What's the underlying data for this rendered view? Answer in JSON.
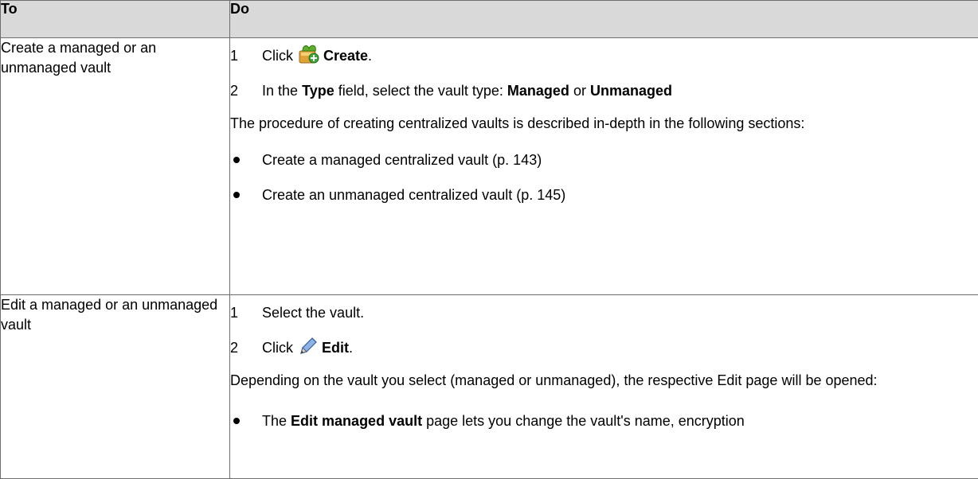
{
  "table": {
    "headers": [
      "To",
      "Do"
    ],
    "rows": [
      {
        "to": "Create a managed or an unmanaged vault",
        "steps": [
          {
            "num": "1",
            "pre": "Click",
            "bold": "Create",
            "post": ".",
            "icon": "create-vault-icon"
          },
          {
            "num": "2",
            "pre": "In the",
            "bold": "Type",
            "mid": "field, select the vault type:",
            "bold2": "Managed",
            "or": "or",
            "bold3": "Unmanaged"
          }
        ],
        "para": "The procedure of creating centralized vaults is described in-depth in the following sections:",
        "bullets": [
          "Create a managed centralized vault (p. 143)",
          "Create an unmanaged centralized vault (p. 145)"
        ]
      },
      {
        "to": "Edit a managed or an unmanaged vault",
        "steps": [
          {
            "num": "1",
            "text": "Select the vault."
          },
          {
            "num": "2",
            "pre": "Click",
            "bold": "Edit",
            "post": ".",
            "icon": "pencil-edit-icon"
          }
        ],
        "para": "Depending on the vault you select (managed or unmanaged), the respective Edit page will be opened:",
        "bullet_partial": {
          "pre": "The",
          "bold": "Edit managed vault",
          "post": "page lets you change the vault's name, encryption"
        }
      }
    ]
  },
  "colors": {
    "header_bg": "#d9d9d9",
    "border": "#6e6e6e"
  }
}
